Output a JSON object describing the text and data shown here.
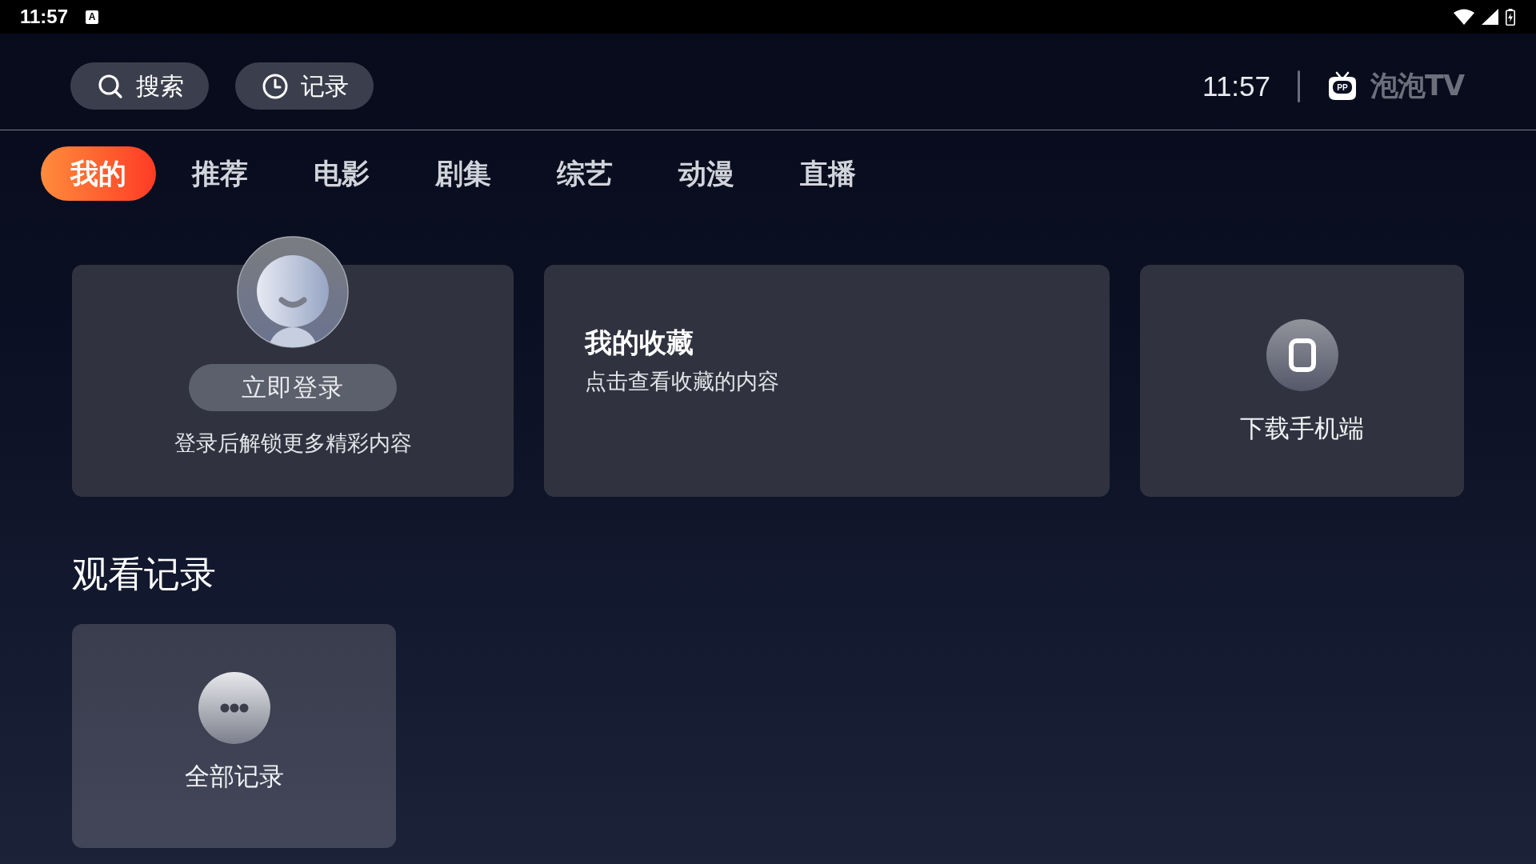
{
  "status_bar": {
    "time": "11:57",
    "notification_badge": "A"
  },
  "top_bar": {
    "buttons": [
      {
        "kind": "search",
        "label": "搜索"
      },
      {
        "kind": "history",
        "label": "记录"
      }
    ],
    "clock": "11:57",
    "logo_mark": "PP",
    "brand": "泡泡TV"
  },
  "tabs": [
    {
      "label": "我的",
      "selected": true
    },
    {
      "label": "推荐",
      "selected": false
    },
    {
      "label": "电影",
      "selected": false
    },
    {
      "label": "剧集",
      "selected": false
    },
    {
      "label": "综艺",
      "selected": false
    },
    {
      "label": "动漫",
      "selected": false
    },
    {
      "label": "直播",
      "selected": false
    }
  ],
  "cards": [
    {
      "kind": "login",
      "button": "立即登录",
      "caption": "登录后解锁更多精彩内容"
    },
    {
      "kind": "favorites",
      "title": "我的收藏",
      "subtitle": "点击查看收藏的内容"
    },
    {
      "kind": "download",
      "label": "下载手机端"
    }
  ],
  "history": {
    "title": "观看记录",
    "items": [
      {
        "kind": "all",
        "label": "全部记录"
      }
    ]
  }
}
